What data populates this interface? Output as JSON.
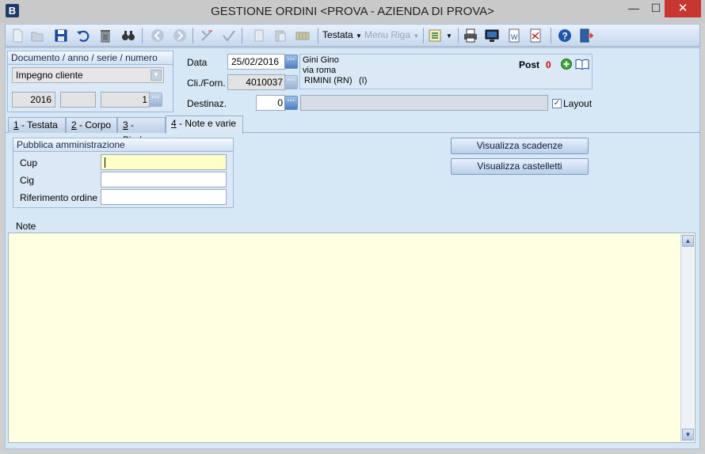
{
  "window": {
    "app_icon": "B",
    "title": "GESTIONE ORDINI <PROVA - AZIENDA DI PROVA>",
    "minimize": "—",
    "maximize": "☐",
    "close": "✕"
  },
  "toolbar": {
    "icons": [
      "new-icon",
      "open-icon",
      "save-icon",
      "undo-icon",
      "delete-icon",
      "find-icon",
      "prev-icon",
      "next-icon",
      "cut-icon",
      "check-icon",
      "copy-icon",
      "paste-icon",
      "grid-icon",
      "list-icon",
      "print-icon",
      "monitor-icon",
      "word-icon",
      "pdf-icon",
      "help-icon",
      "exit-icon"
    ],
    "testata_menu": "Testata",
    "menu_riga": "Menu Riga"
  },
  "document": {
    "group_title": "Documento / anno / serie / numero",
    "type": "Impegno cliente",
    "year": "2016",
    "series": "",
    "number": "1"
  },
  "header": {
    "data_label": "Data",
    "data_value": "25/02/2016",
    "cliforn_label": "Cli./Forn.",
    "cliforn_value": "4010037",
    "destinaz_label": "Destinaz.",
    "destinaz_value": "0",
    "customer_name": "Gini Gino",
    "customer_street": "via roma",
    "customer_city": "RIMINI (RN)",
    "customer_country": "(I)",
    "post_label": "Post",
    "post_count": "0",
    "layout_label": "Layout",
    "layout_checked": true
  },
  "tabs": [
    {
      "key": "1",
      "label": " - Testata"
    },
    {
      "key": "2",
      "label": " - Corpo"
    },
    {
      "key": "3",
      "label": " - Piede"
    },
    {
      "key": "4",
      "label": " - Note e varie"
    }
  ],
  "pa": {
    "group_title": "Pubblica amministrazione",
    "cup_label": "Cup",
    "cup_value": "",
    "cig_label": "Cig",
    "cig_value": "",
    "rif_label": "Riferimento ordine",
    "rif_value": ""
  },
  "buttons": {
    "scadenze": "Visualizza scadenze",
    "castelletti": "Visualizza castelletti"
  },
  "notes": {
    "label": "Note",
    "value": ""
  },
  "colors": {
    "accent": "#4e7fc2",
    "post_count": "#d40000",
    "notes_bg": "#ffffe1",
    "cup_bg": "#ffffc8"
  }
}
